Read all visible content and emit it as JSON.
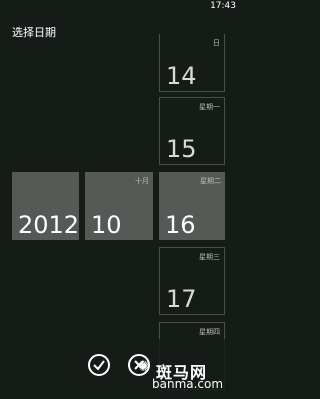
{
  "status_bar": {
    "time": "17:43"
  },
  "page": {
    "title": "选择日期"
  },
  "picker": {
    "year": {
      "value": "2012"
    },
    "month": {
      "value": "10",
      "sub": "十月"
    },
    "day_tiles": [
      {
        "value": "14",
        "sub": "日",
        "selected": false
      },
      {
        "value": "15",
        "sub": "星期一",
        "selected": false
      },
      {
        "value": "16",
        "sub": "星期二",
        "selected": true
      },
      {
        "value": "17",
        "sub": "星期三",
        "selected": false
      },
      {
        "value": "",
        "sub": "星期四",
        "selected": false
      }
    ]
  },
  "app_bar": {
    "buttons": [
      {
        "name": "confirm-button",
        "icon": "checkmark-icon"
      },
      {
        "name": "cancel-button",
        "icon": "close-icon"
      }
    ]
  },
  "watermark": {
    "brand": "斑马网",
    "url": "banma.com"
  },
  "colors": {
    "background": "#151c18",
    "selected_tile": "#555a56",
    "tile_border": "#4a4f4c"
  }
}
